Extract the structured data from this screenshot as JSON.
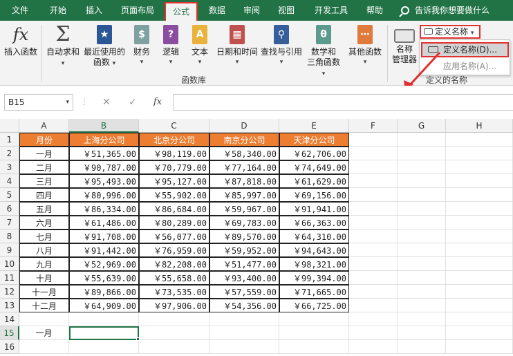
{
  "tabs": [
    "文件",
    "开始",
    "插入",
    "页面布局",
    "公式",
    "数据",
    "审阅",
    "视图",
    "开发工具",
    "帮助"
  ],
  "active_tab": "公式",
  "tell_me": "告诉我你想要做什么",
  "ribbon": {
    "insert_function": "插入函数",
    "autosum": "自动求和",
    "recent": [
      "最近使用的",
      "函数"
    ],
    "financial": "财务",
    "logical": "逻辑",
    "text": "文本",
    "datetime": "日期和时间",
    "lookup": "查找与引用",
    "math": [
      "数学和",
      "三角函数"
    ],
    "other": "其他函数",
    "group_library": "函数库",
    "name_manager": [
      "名称",
      "管理器"
    ],
    "define_name_button": "定义名称",
    "group_defined": "定义的名称"
  },
  "dropdown": {
    "item1": "定义名称(D)...",
    "item2": "应用名称(A)..."
  },
  "formula_bar": {
    "name_box": "B15",
    "cancel": "✕",
    "enter": "✓",
    "fx": "fx",
    "value": ""
  },
  "grid": {
    "columns": [
      "A",
      "B",
      "C",
      "D",
      "E",
      "F",
      "G",
      "H"
    ],
    "rows": [
      "1",
      "2",
      "3",
      "4",
      "5",
      "6",
      "7",
      "8",
      "9",
      "10",
      "11",
      "12",
      "13",
      "14",
      "15",
      "16"
    ],
    "header": [
      "月份",
      "上海分公司",
      "北京分公司",
      "南京分公司",
      "天津分公司"
    ],
    "data": [
      [
        "一月",
        "￥51,365.00",
        "￥98,119.00",
        "￥58,340.00",
        "￥62,706.00"
      ],
      [
        "二月",
        "￥90,787.00",
        "￥70,779.00",
        "￥77,164.00",
        "￥74,649.00"
      ],
      [
        "三月",
        "￥95,493.00",
        "￥95,127.00",
        "￥87,818.00",
        "￥61,629.00"
      ],
      [
        "四月",
        "￥80,996.00",
        "￥55,902.00",
        "￥85,997.00",
        "￥69,156.00"
      ],
      [
        "五月",
        "￥86,334.00",
        "￥86,684.00",
        "￥59,967.00",
        "￥91,941.00"
      ],
      [
        "六月",
        "￥61,486.00",
        "￥80,289.00",
        "￥69,783.00",
        "￥66,363.00"
      ],
      [
        "七月",
        "￥91,708.00",
        "￥56,077.00",
        "￥89,570.00",
        "￥64,310.00"
      ],
      [
        "八月",
        "￥91,442.00",
        "￥76,959.00",
        "￥59,952.00",
        "￥94,643.00"
      ],
      [
        "九月",
        "￥52,969.00",
        "￥82,208.00",
        "￥51,477.00",
        "￥98,321.00"
      ],
      [
        "十月",
        "￥55,639.00",
        "￥55,658.00",
        "￥93,400.00",
        "￥99,394.00"
      ],
      [
        "十一月",
        "￥89,866.00",
        "￥73,535.00",
        "￥57,559.00",
        "￥71,665.00"
      ],
      [
        "十二月",
        "￥64,909.00",
        "￥97,906.00",
        "￥54,356.00",
        "￥66,725.00"
      ]
    ],
    "a15": "一月",
    "selected_cell": "B15"
  },
  "colors": {
    "excel_green": "#217346",
    "header_orange": "#ed7d31",
    "highlight_red": "#e0302f"
  }
}
